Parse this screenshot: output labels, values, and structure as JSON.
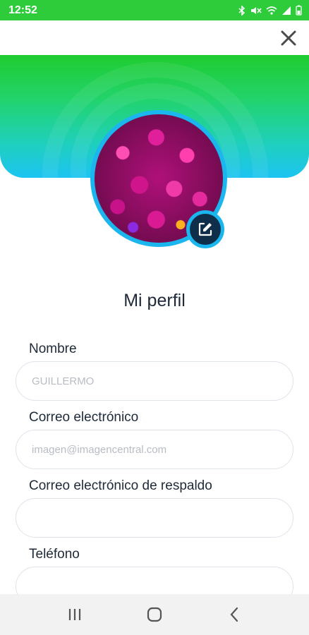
{
  "status": {
    "time": "12:52",
    "icons": [
      "bluetooth-icon",
      "mute-icon",
      "wifi-icon",
      "signal-icon",
      "battery-icon"
    ]
  },
  "header": {
    "close_icon": "close-icon",
    "gradient_colors": [
      "#1fcc2f",
      "#1cc4f2"
    ]
  },
  "profile": {
    "edit_icon": "edit-icon",
    "title": "Mi perfil"
  },
  "form": {
    "fields": [
      {
        "label": "Nombre",
        "value": "GUILLERMO",
        "placeholder": ""
      },
      {
        "label": "Correo electrónico",
        "value": "imagen@imagencentral.com",
        "placeholder": ""
      },
      {
        "label": "Correo electrónico de respaldo",
        "value": "",
        "placeholder": ""
      },
      {
        "label": "Teléfono",
        "value": "",
        "placeholder": ""
      }
    ]
  },
  "nav": {
    "icons": [
      "recent-apps-icon",
      "home-icon",
      "back-icon"
    ]
  },
  "colors": {
    "status_bar": "#2ecc3a",
    "accent": "#1bb6ee",
    "badge": "#0f2e4a"
  }
}
